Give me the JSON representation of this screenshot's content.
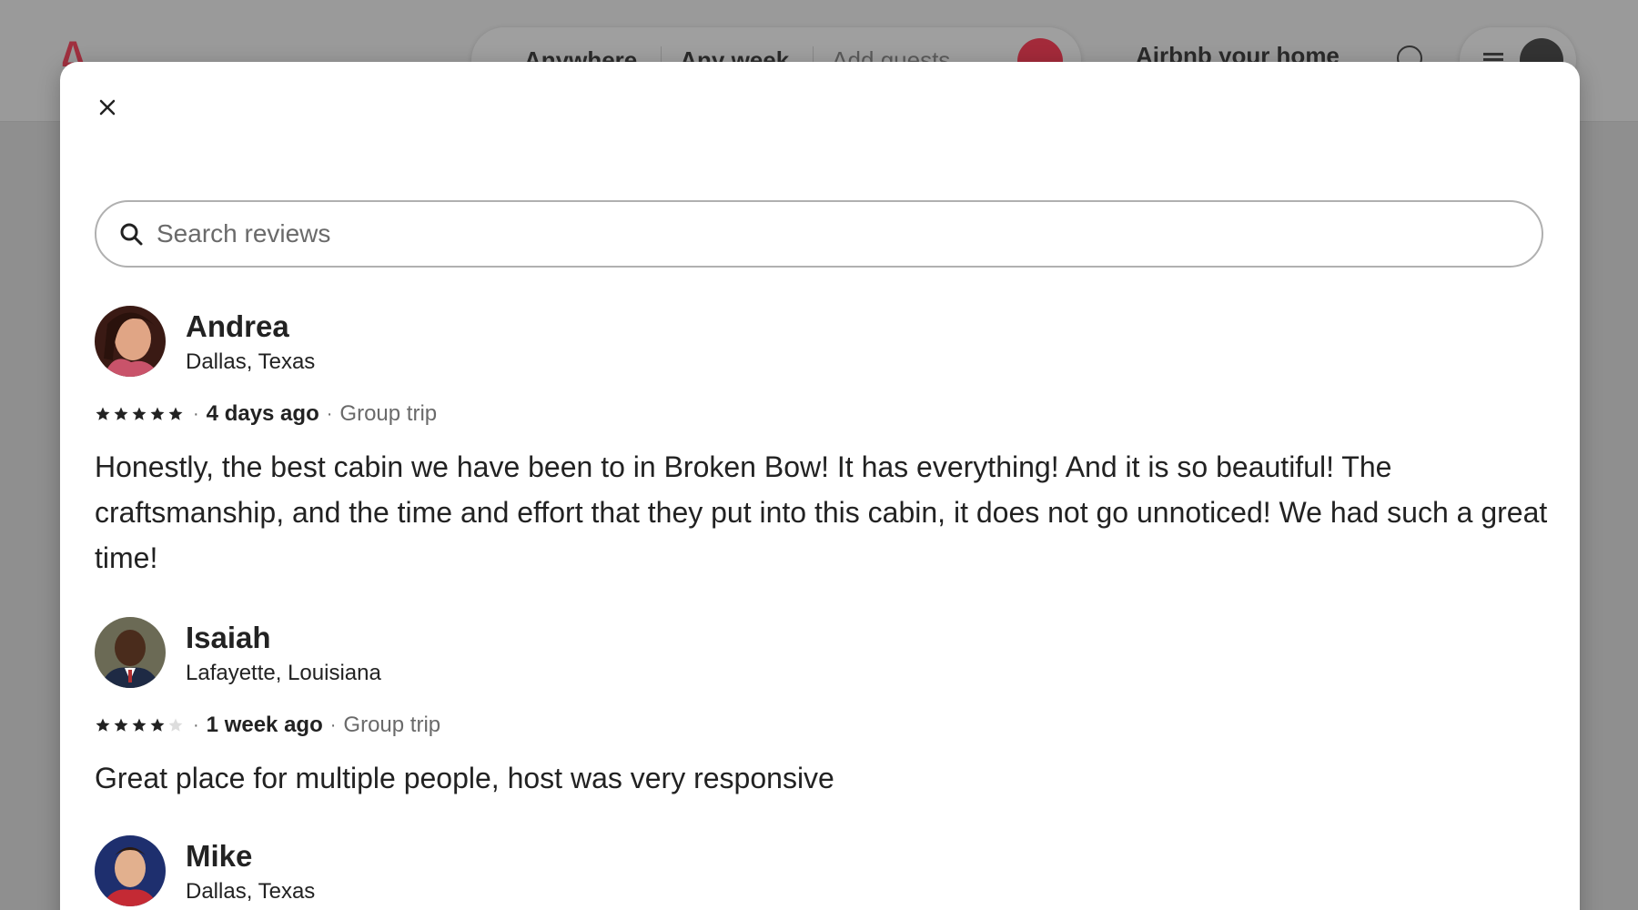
{
  "background": {
    "search_segments": [
      "Anywhere",
      "Any week",
      "Add guests"
    ],
    "host_link": "Airbnb your home"
  },
  "modal": {
    "search": {
      "placeholder": "Search reviews",
      "value": ""
    },
    "reviews": [
      {
        "name": "Andrea",
        "location": "Dallas, Texas",
        "rating": 5,
        "when": "4 days ago",
        "trip_type": "Group trip",
        "text": "Honestly, the best cabin we have been to in Broken Bow! It has everything! And it is so beautiful! The craftsmanship, and the time and effort that they put into this cabin, it does not go unnoticed! We had such a great time!"
      },
      {
        "name": "Isaiah",
        "location": "Lafayette, Louisiana",
        "rating": 4,
        "when": "1 week ago",
        "trip_type": "Group trip",
        "text": "Great place for multiple people, host was very responsive"
      },
      {
        "name": "Mike",
        "location": "Dallas, Texas"
      }
    ]
  },
  "icons": {
    "close": "close-icon",
    "search": "search-icon",
    "star": "star-icon"
  },
  "colors": {
    "brand": "#FF385C",
    "overlay": "#8f8f8f",
    "text": "#222222",
    "muted": "#6a6a6a"
  }
}
